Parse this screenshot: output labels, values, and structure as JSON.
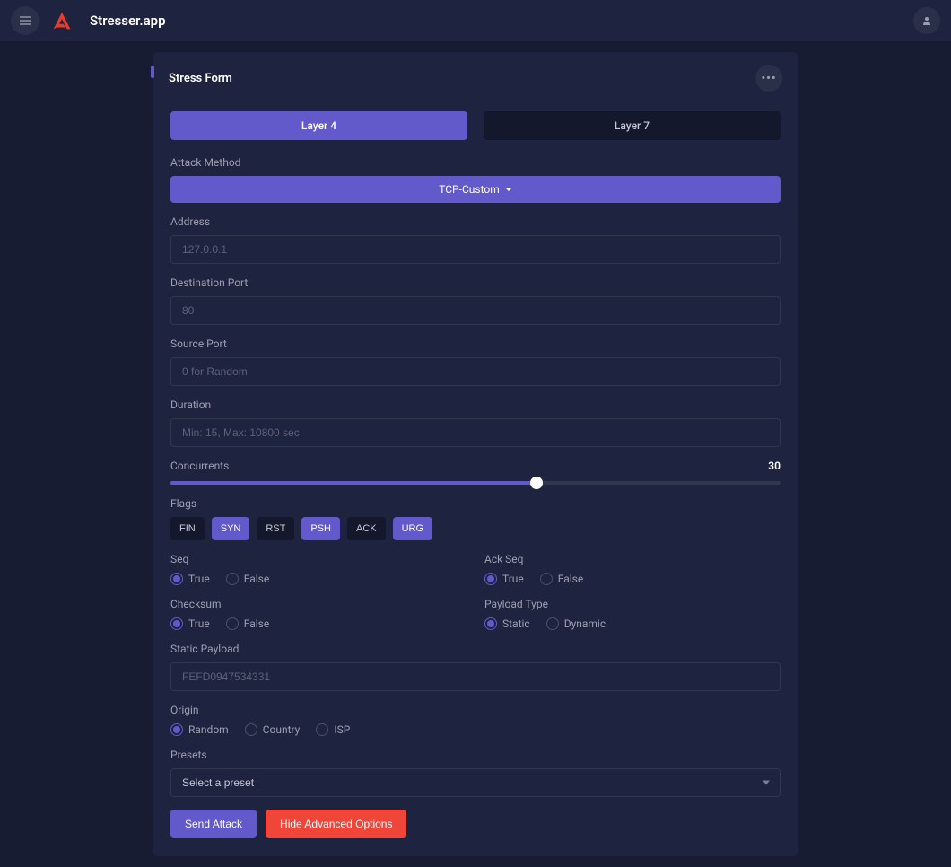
{
  "app": {
    "title": "Stresser.app"
  },
  "card": {
    "title": "Stress Form"
  },
  "tabs": {
    "layer4": "Layer 4",
    "layer7": "Layer 7",
    "active": "layer4"
  },
  "method": {
    "label": "Attack Method",
    "value": "TCP-Custom"
  },
  "address": {
    "label": "Address",
    "placeholder": "127.0.0.1",
    "value": ""
  },
  "dport": {
    "label": "Destination Port",
    "placeholder": "80",
    "value": ""
  },
  "sport": {
    "label": "Source Port",
    "placeholder": "0 for Random",
    "value": ""
  },
  "duration": {
    "label": "Duration",
    "placeholder": "Min: 15, Max: 10800 sec",
    "value": ""
  },
  "concurrents": {
    "label": "Concurrents",
    "value": "30",
    "percent": 60
  },
  "flags": {
    "label": "Flags",
    "items": [
      {
        "name": "FIN",
        "active": false
      },
      {
        "name": "SYN",
        "active": true
      },
      {
        "name": "RST",
        "active": false
      },
      {
        "name": "PSH",
        "active": true
      },
      {
        "name": "ACK",
        "active": false
      },
      {
        "name": "URG",
        "active": true
      }
    ]
  },
  "seq": {
    "label": "Seq",
    "value": "True",
    "options": [
      "True",
      "False"
    ]
  },
  "ackseq": {
    "label": "Ack Seq",
    "value": "True",
    "options": [
      "True",
      "False"
    ]
  },
  "checksum": {
    "label": "Checksum",
    "value": "True",
    "options": [
      "True",
      "False"
    ]
  },
  "payloadtype": {
    "label": "Payload Type",
    "value": "Static",
    "options": [
      "Static",
      "Dynamic"
    ]
  },
  "staticpayload": {
    "label": "Static Payload",
    "placeholder": "FEFD0947534331",
    "value": ""
  },
  "origin": {
    "label": "Origin",
    "value": "Random",
    "options": [
      "Random",
      "Country",
      "ISP"
    ]
  },
  "presets": {
    "label": "Presets",
    "placeholder": "Select a preset"
  },
  "buttons": {
    "send": "Send Attack",
    "hide": "Hide Advanced Options"
  }
}
